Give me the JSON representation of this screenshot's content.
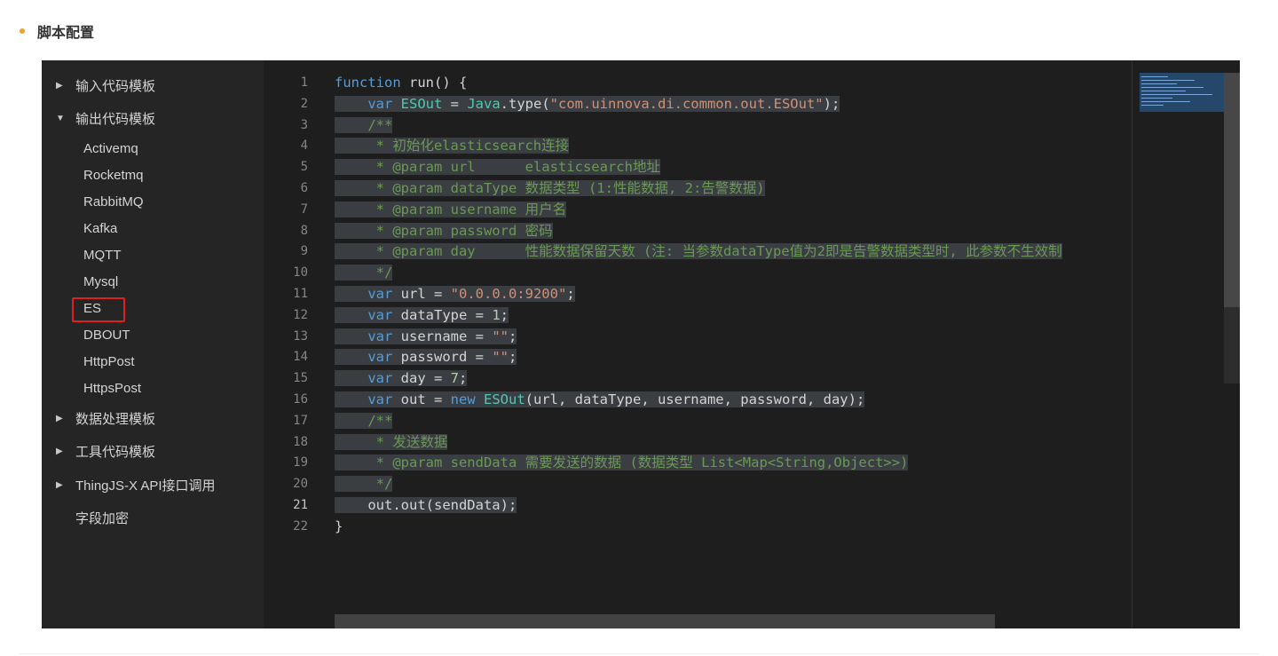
{
  "section": {
    "title": "脚本配置"
  },
  "sidebar": {
    "groups": [
      {
        "label": "输入代码模板",
        "arrow": "▶"
      },
      {
        "label": "输出代码模板",
        "arrow": "▼"
      }
    ],
    "leaves": [
      "Activemq",
      "Rocketmq",
      "RabbitMQ",
      "Kafka",
      "MQTT",
      "Mysql",
      "ES",
      "DBOUT",
      "HttpPost",
      "HttpsPost"
    ],
    "tail_groups": [
      {
        "label": "数据处理模板",
        "arrow": "▶"
      },
      {
        "label": "工具代码模板",
        "arrow": "▶"
      },
      {
        "label": "ThingJS-X API接口调用",
        "arrow": "▶"
      },
      {
        "label": "字段加密",
        "arrow": ""
      }
    ],
    "selected": "ES"
  },
  "editor": {
    "line_numbers": [
      "1",
      "2",
      "3",
      "4",
      "5",
      "6",
      "7",
      "8",
      "9",
      "10",
      "11",
      "12",
      "13",
      "14",
      "15",
      "16",
      "17",
      "18",
      "19",
      "20",
      "21",
      "22"
    ],
    "active_line": "21"
  },
  "colors": {
    "accent_dot": "#f0a030",
    "highlight_box": "#e02020",
    "editor_bg": "#1e1e1e",
    "sidebar_bg": "#252526"
  }
}
